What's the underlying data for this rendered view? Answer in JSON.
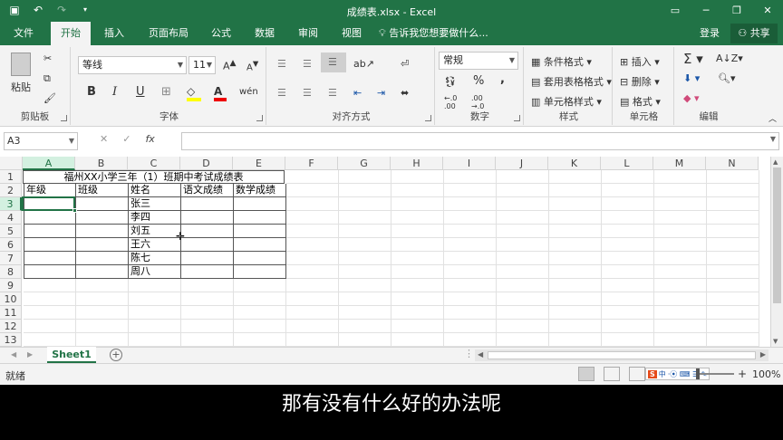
{
  "window": {
    "title": "成绩表.xlsx - Excel",
    "qat_icons": [
      "save-icon",
      "undo-icon",
      "redo-icon",
      "customize-qat-icon"
    ],
    "controls": [
      "ribbon-display-icon",
      "minimize-icon",
      "restore-icon",
      "close-icon"
    ]
  },
  "tabs": {
    "file": "文件",
    "home": "开始",
    "insert": "插入",
    "page_layout": "页面布局",
    "formulas": "公式",
    "data": "数据",
    "review": "审阅",
    "view": "视图",
    "tell_me": "告诉我您想要做什么...",
    "login": "登录",
    "share": "共享"
  },
  "ribbon": {
    "clipboard": {
      "label": "剪贴板",
      "paste": "粘贴"
    },
    "font": {
      "label": "字体",
      "name": "等线",
      "size": "11",
      "bold": "B",
      "italic": "I",
      "underline": "U"
    },
    "alignment": {
      "label": "对齐方式"
    },
    "number": {
      "label": "数字",
      "format": "常规",
      "percent": "%",
      "comma": ","
    },
    "styles": {
      "label": "样式",
      "conditional": "条件格式",
      "table": "套用表格格式",
      "cell_styles": "单元格样式"
    },
    "cells": {
      "label": "单元格",
      "insert": "插入",
      "delete": "删除",
      "format": "格式"
    },
    "editing": {
      "label": "编辑"
    }
  },
  "formula_bar": {
    "name_box": "A3",
    "cancel": "✕",
    "enter": "✓",
    "fx": "fx",
    "content": ""
  },
  "sheet": {
    "columns": [
      "A",
      "B",
      "C",
      "D",
      "E",
      "F",
      "G",
      "H",
      "I",
      "J",
      "K",
      "L",
      "M",
      "N"
    ],
    "rows": [
      "1",
      "2",
      "3",
      "4",
      "5",
      "6",
      "7",
      "8",
      "9",
      "10",
      "11",
      "12",
      "13"
    ],
    "title": "福州XX小学三年（1）班期中考试成绩表",
    "headers": [
      "年级",
      "班级",
      "姓名",
      "语文成绩",
      "数学成绩"
    ],
    "names": [
      "张三",
      "李四",
      "刘五",
      "王六",
      "陈七",
      "周八"
    ],
    "selected_cell": "A3"
  },
  "sheet_tabs": {
    "active": "Sheet1",
    "add": "+"
  },
  "status": {
    "ready": "就绪",
    "zoom": "100%",
    "ime": "中"
  },
  "subtitle": "那有没有什么好的办法呢"
}
